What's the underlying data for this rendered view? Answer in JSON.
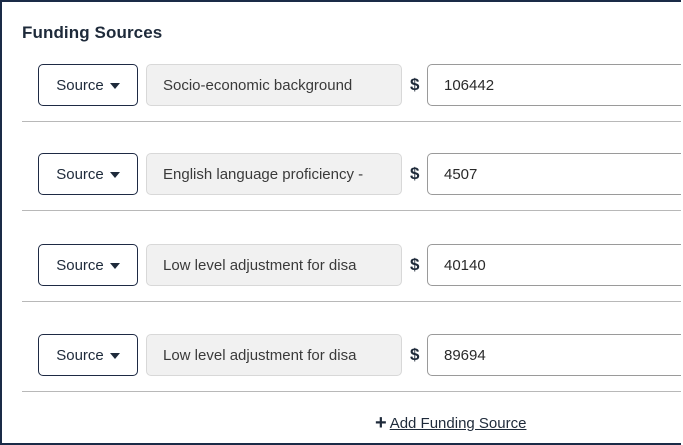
{
  "title": "Funding Sources",
  "rows": [
    {
      "source_label": "Source",
      "description": "Socio-economic background",
      "currency": "$",
      "amount": "106442"
    },
    {
      "source_label": "Source",
      "description": "English language proficiency -",
      "currency": "$",
      "amount": "4507"
    },
    {
      "source_label": "Source",
      "description": "Low level adjustment for disa",
      "currency": "$",
      "amount": "40140"
    },
    {
      "source_label": "Source",
      "description": "Low level adjustment for disa",
      "currency": "$",
      "amount": "89694"
    }
  ],
  "add_link": {
    "icon": "plus-icon",
    "label": "Add Funding Source"
  }
}
